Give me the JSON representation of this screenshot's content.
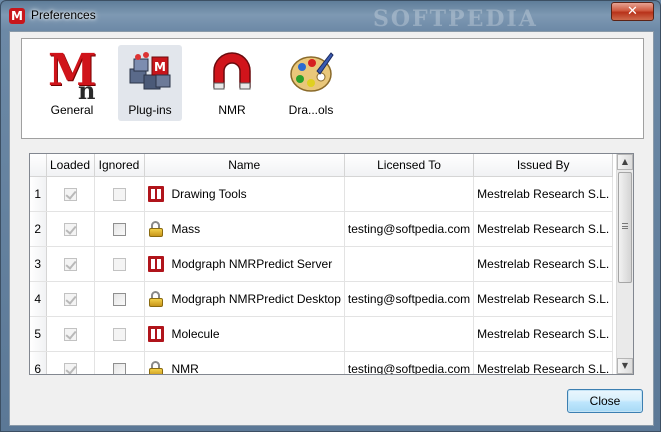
{
  "window": {
    "title": "Preferences",
    "app_icon_letter": "M",
    "watermark": "SOFTPEDIA",
    "close_glyph": "✕"
  },
  "categories": [
    {
      "label": "General",
      "icon": "mestrenova-logo-icon",
      "selected": false
    },
    {
      "label": "Plug-ins",
      "icon": "plugins-blocks-icon",
      "selected": true
    },
    {
      "label": "NMR",
      "icon": "nmr-magnet-icon",
      "selected": false
    },
    {
      "label": "Dra...ols",
      "icon": "drawing-palette-icon",
      "selected": false
    }
  ],
  "table": {
    "columns": [
      "",
      "Loaded",
      "Ignored",
      "Name",
      "Licensed To",
      "Issued By"
    ],
    "rows": [
      {
        "num": "1",
        "loaded": true,
        "ignored": false,
        "ignored_enabled": false,
        "icon": "plugin-m-icon",
        "name": "Drawing Tools",
        "licensed_to": "",
        "issued_by": "Mestrelab Research S.L."
      },
      {
        "num": "2",
        "loaded": true,
        "ignored": false,
        "ignored_enabled": true,
        "icon": "padlock-icon",
        "name": "Mass",
        "licensed_to": "testing@softpedia.com",
        "issued_by": "Mestrelab Research S.L."
      },
      {
        "num": "3",
        "loaded": true,
        "ignored": false,
        "ignored_enabled": false,
        "icon": "plugin-m-icon",
        "name": "Modgraph NMRPredict Server",
        "licensed_to": "",
        "issued_by": "Mestrelab Research S.L."
      },
      {
        "num": "4",
        "loaded": true,
        "ignored": false,
        "ignored_enabled": true,
        "icon": "padlock-icon",
        "name": "Modgraph NMRPredict Desktop",
        "licensed_to": "testing@softpedia.com",
        "issued_by": "Mestrelab Research S.L."
      },
      {
        "num": "5",
        "loaded": true,
        "ignored": false,
        "ignored_enabled": false,
        "icon": "plugin-m-icon",
        "name": "Molecule",
        "licensed_to": "",
        "issued_by": "Mestrelab Research S.L."
      },
      {
        "num": "6",
        "loaded": true,
        "ignored": false,
        "ignored_enabled": true,
        "icon": "padlock-icon",
        "name": "NMR",
        "licensed_to": "testing@softpedia.com",
        "issued_by": "Mestrelab Research S.L."
      }
    ]
  },
  "buttons": {
    "close": "Close"
  },
  "scrollbar": {
    "up_glyph": "▲",
    "down_glyph": "▼"
  }
}
